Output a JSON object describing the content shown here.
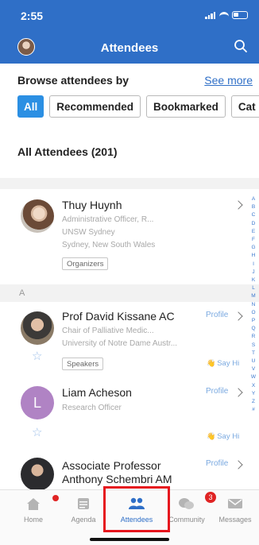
{
  "status": {
    "time": "2:55"
  },
  "header": {
    "title": "Attendees"
  },
  "browse": {
    "label": "Browse attendees by",
    "see_more": "See more"
  },
  "chips": [
    {
      "label": "All",
      "active": true
    },
    {
      "label": "Recommended",
      "active": false
    },
    {
      "label": "Bookmarked",
      "active": false
    },
    {
      "label": "Cat",
      "active": false
    }
  ],
  "list_title": "All Attendees (201)",
  "section_letter": "A",
  "attendees": [
    {
      "name": "Thuy Huynh",
      "lines": [
        "Administrative Officer, R...",
        "UNSW Sydney",
        "Sydney, New South Wales"
      ],
      "tag": "Organizers"
    },
    {
      "name": "Prof David Kissane AC",
      "lines": [
        "Chair of Palliative Medic...",
        "University of Notre Dame Austr..."
      ],
      "tag": "Speakers",
      "profile": "Profile",
      "say_hi": "Say Hi"
    },
    {
      "name": "Liam Acheson",
      "initial": "L",
      "lines": [
        "Research Officer"
      ],
      "profile": "Profile",
      "say_hi": "Say Hi"
    },
    {
      "name_lines": [
        "Associate Professor",
        "Anthony Schembri AM"
      ],
      "profile": "Profile"
    }
  ],
  "az_index": [
    "A",
    "B",
    "C",
    "D",
    "E",
    "F",
    "G",
    "H",
    "I",
    "J",
    "K",
    "L",
    "M",
    "N",
    "O",
    "P",
    "Q",
    "R",
    "S",
    "T",
    "U",
    "V",
    "W",
    "X",
    "Y",
    "Z",
    "#"
  ],
  "tabs": [
    {
      "label": "Home"
    },
    {
      "label": "Agenda"
    },
    {
      "label": "Attendees"
    },
    {
      "label": "Community",
      "badge": "3"
    },
    {
      "label": "Messages"
    }
  ],
  "colors": {
    "header": "#2f6fc7",
    "chip_active": "#2b8fe3",
    "link": "#2f6fc7",
    "badge": "#e02424",
    "highlight": "#e6161e"
  }
}
